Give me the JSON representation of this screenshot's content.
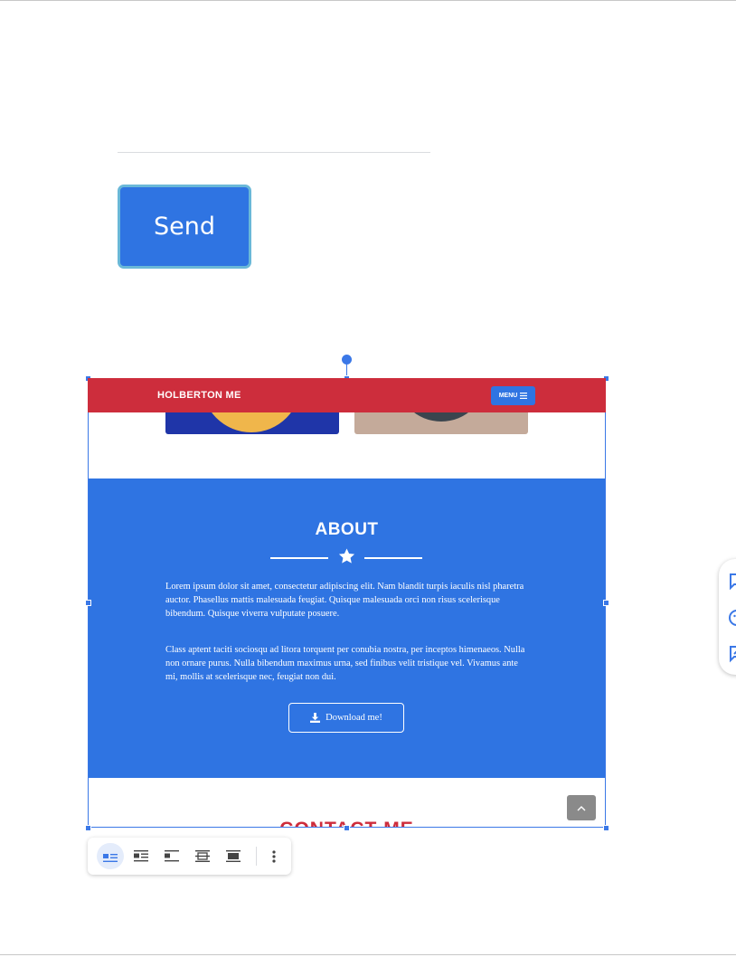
{
  "form": {
    "send_label": "Send"
  },
  "embedded_site": {
    "brand": "HOLBERTON ME",
    "menu_label": "MENU",
    "about": {
      "title": "ABOUT",
      "paragraph_1": "Lorem ipsum dolor sit amet, consectetur adipiscing elit. Nam blandit turpis iaculis nisl pharetra auctor. Phasellus mattis malesuada feugiat. Quisque malesuada orci non risus scelerisque bibendum. Quisque viverra vulputate posuere.",
      "paragraph_2": "Class aptent taciti sociosqu ad litora torquent per conubia nostra, per inceptos himenaeos. Nulla non ornare purus. Nulla bibendum maximus urna, sed finibus velit tristique vel. Vivamus ante mi, mollis at scelerisque nec, feugiat non dui.",
      "download_label": "Download me!"
    },
    "contact_title": "CONTACT ME"
  },
  "toolbar": {
    "options": [
      "inline",
      "wrap-text",
      "break-text",
      "behind-text",
      "in-front-of-text"
    ],
    "selected": "inline"
  },
  "colors": {
    "primary_blue": "#2f74e2",
    "header_red": "#cd2d3c",
    "selection_blue": "#3b78e7"
  },
  "icons": [
    "menu-icon",
    "star-icon",
    "download-icon",
    "chevron-up-icon",
    "more-vert-icon",
    "add-comment-icon",
    "emoji-icon",
    "suggest-edit-icon"
  ]
}
